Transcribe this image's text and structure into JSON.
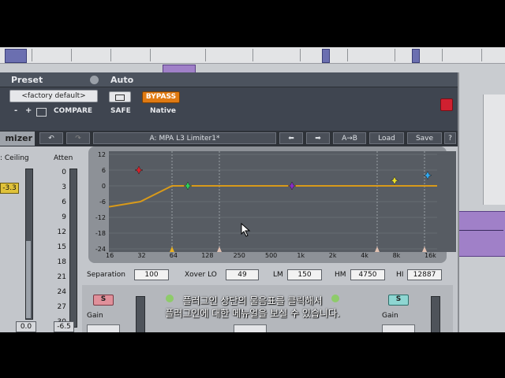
{
  "header": {
    "preset_label": "Preset",
    "auto_label": "Auto",
    "preset_value": "<factory default>",
    "minus": "-",
    "plus": "+",
    "compare": "COMPARE",
    "safe": "SAFE",
    "bypass": "BYPASS",
    "native": "Native"
  },
  "toolbar": {
    "plugin_name_partial": "mizer",
    "preset_name": "A: MPA L3 Limiter1*",
    "ab": "A→B",
    "load": "Load",
    "save": "Save",
    "help": "?"
  },
  "left": {
    "ceiling_label": ": Ceiling",
    "ceiling_value": "-3.3",
    "atten_label": "Atten",
    "atten_scale": [
      "0",
      "3",
      "6",
      "9",
      "12",
      "15",
      "18",
      "21",
      "24",
      "27",
      "30"
    ],
    "bottom_left_value": "0.0",
    "bottom_right_value": "-6.5"
  },
  "graph": {
    "y_ticks": [
      "12",
      "6",
      "0",
      "-6",
      "-12",
      "-18",
      "-24"
    ],
    "x_ticks": [
      "16",
      "32",
      "64",
      "128",
      "250",
      "500",
      "1k",
      "2k",
      "4k",
      "8k",
      "16k"
    ],
    "colors": {
      "curve": "#d89a1a",
      "red": "#d8202a",
      "green": "#2ccf5a",
      "purple": "#8a2bc8",
      "yellow": "#e8df2a",
      "blue": "#30a8f0"
    }
  },
  "crossover": {
    "separation_label": "Separation",
    "separation_value": "100",
    "xover_lo_label": "Xover LO",
    "xover_lo_value": "49",
    "lm_label": "LM",
    "lm_value": "150",
    "hm_label": "HM",
    "hm_value": "4750",
    "hi_label": "HI",
    "hi_value": "12887"
  },
  "bands": {
    "solo_label": "S",
    "gain_label": "Gain"
  },
  "subtitle": {
    "line1": "플러그인 상단의 물음표를 클릭해서",
    "line2": "플러그인에 대한 메뉴얼을 보실 수 있습니다."
  }
}
